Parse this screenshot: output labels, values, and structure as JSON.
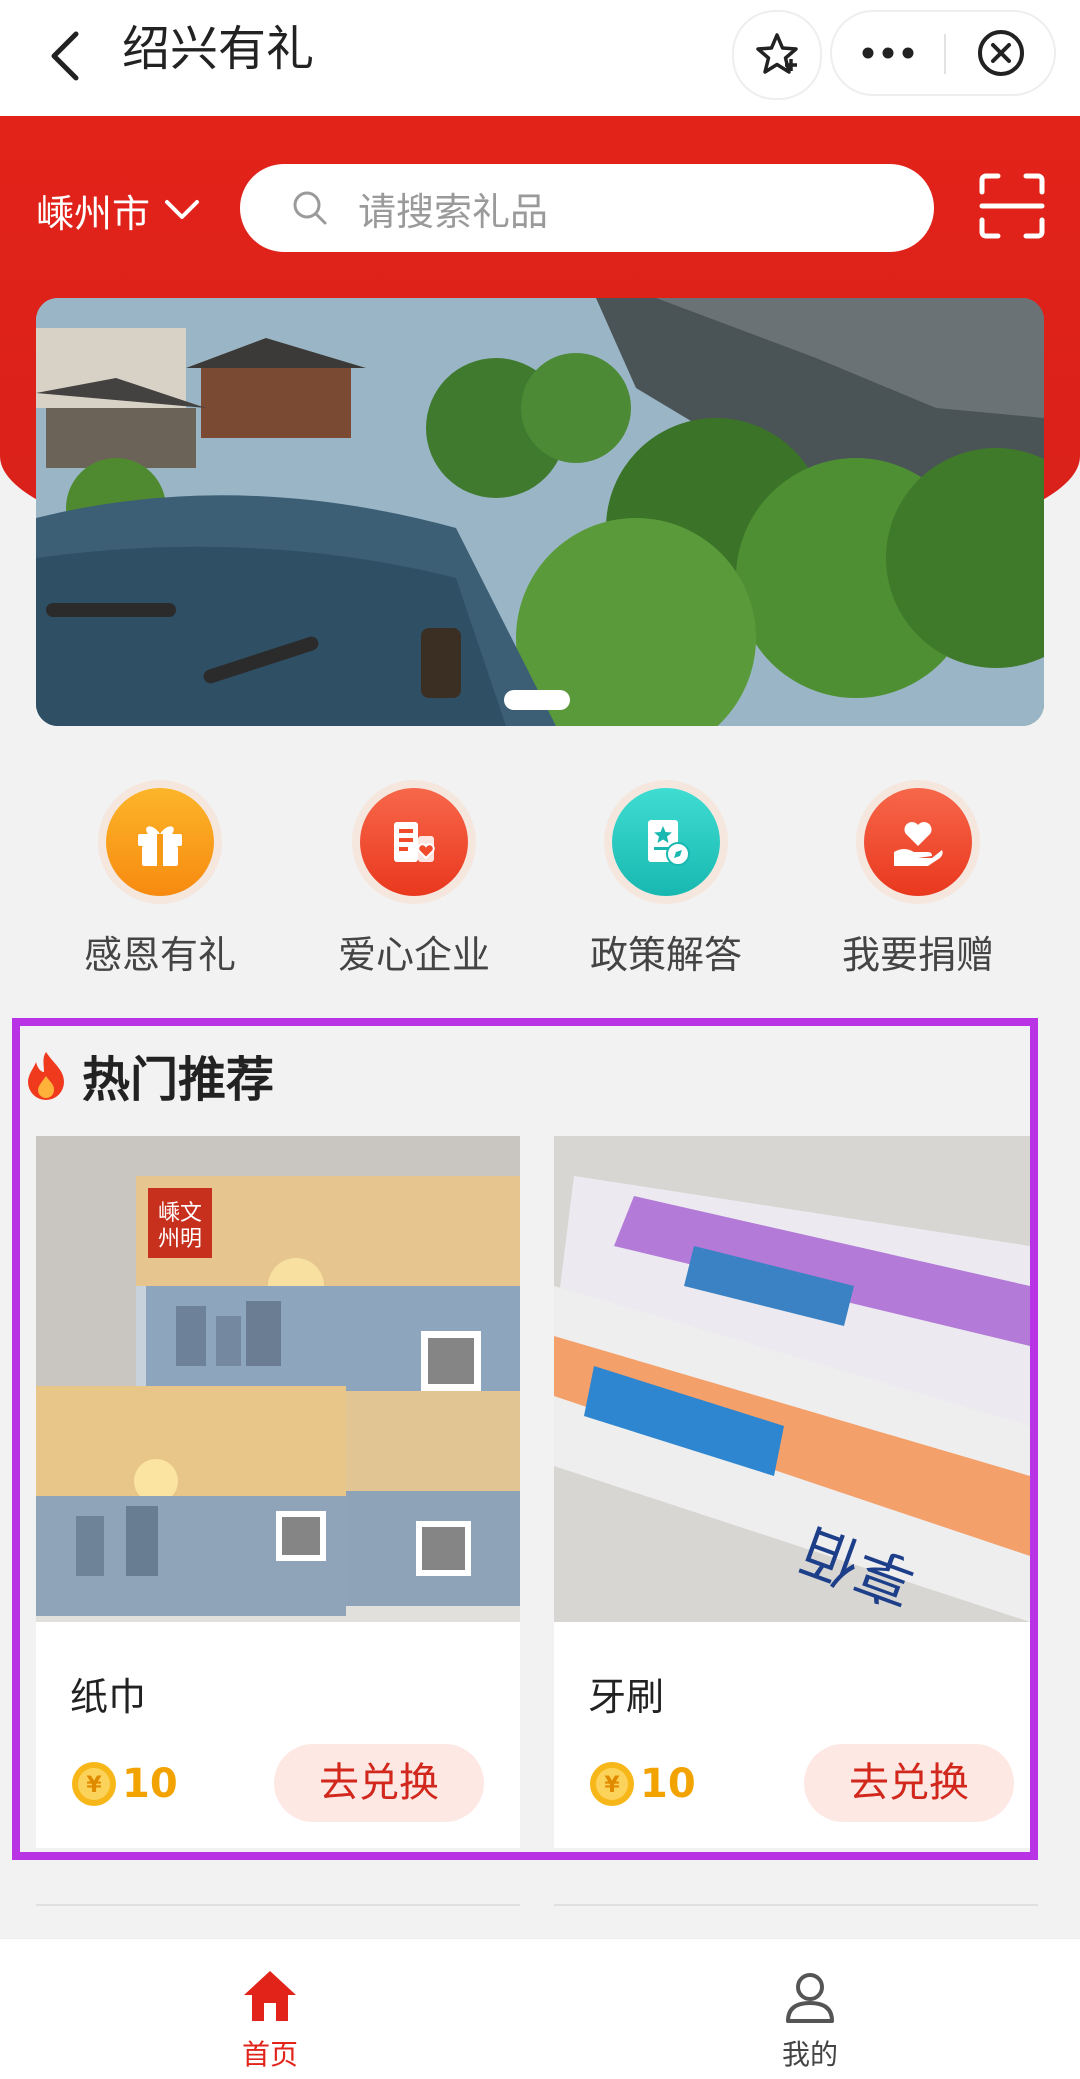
{
  "header": {
    "title": "绍兴有礼"
  },
  "city": {
    "name": "嵊州市"
  },
  "search": {
    "placeholder": "请搜索礼品"
  },
  "quick_entries": [
    {
      "label": "感恩有礼",
      "icon": "gift-icon",
      "color": "#f79a17"
    },
    {
      "label": "爱心企业",
      "icon": "enterprise-heart-icon",
      "color": "#f04b2b"
    },
    {
      "label": "政策解答",
      "icon": "policy-icon",
      "color": "#2ec8c1"
    },
    {
      "label": "我要捐赠",
      "icon": "donate-hand-heart-icon",
      "color": "#f04b2b"
    }
  ],
  "hot": {
    "title": "热门推荐",
    "products": [
      {
        "name": "纸巾",
        "points": "10",
        "redeem_label": "去兑换"
      },
      {
        "name": "牙刷",
        "points": "10",
        "redeem_label": "去兑换"
      }
    ],
    "box_label": "文明嵊州"
  },
  "tabs": [
    {
      "label": "首页",
      "active": true
    },
    {
      "label": "我的",
      "active": false
    }
  ],
  "colors": {
    "brand_red": "#e2231a",
    "accent_purple": "#b833e6",
    "points_gold": "#f2a300"
  }
}
